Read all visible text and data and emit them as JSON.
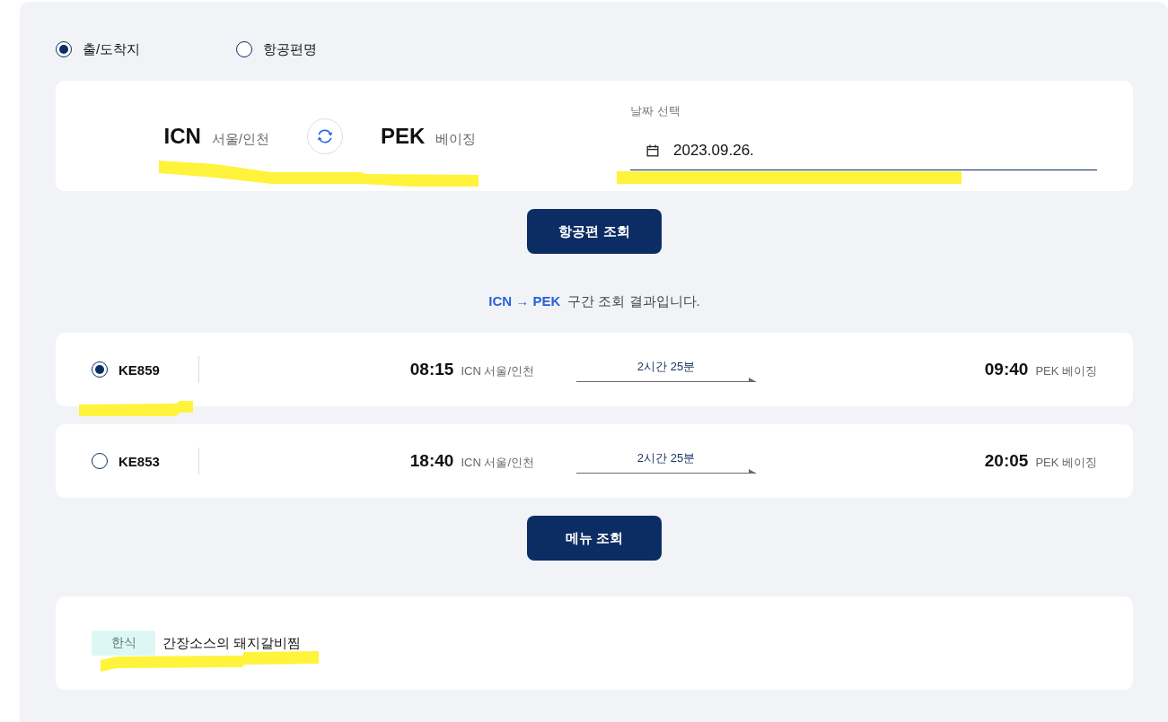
{
  "search_mode": [
    {
      "label": "출/도착지",
      "selected": true
    },
    {
      "label": "항공편명",
      "selected": false
    }
  ],
  "route_search": {
    "origin": {
      "code": "ICN",
      "city": "서울/인천"
    },
    "destination": {
      "code": "PEK",
      "city": "베이징"
    },
    "date": {
      "label": "날짜 선택",
      "value": "2023.09.26."
    }
  },
  "search_button": "항공편 조회",
  "result_message": {
    "route": "ICN → PEK",
    "text": "구간 조회 결과입니다."
  },
  "flights": [
    {
      "number": "KE859",
      "selected": true,
      "departure": {
        "time": "08:15",
        "airport": "ICN 서울/인천"
      },
      "duration": "2시간 25분",
      "arrival": {
        "time": "09:40",
        "airport": "PEK 베이징"
      }
    },
    {
      "number": "KE853",
      "selected": false,
      "departure": {
        "time": "18:40",
        "airport": "ICN 서울/인천"
      },
      "duration": "2시간 25분",
      "arrival": {
        "time": "20:05",
        "airport": "PEK 베이징"
      }
    }
  ],
  "menu_button": "메뉴 조회",
  "menu_items": [
    {
      "category": "한식",
      "name": "간장소스의 돼지갈비찜"
    }
  ]
}
